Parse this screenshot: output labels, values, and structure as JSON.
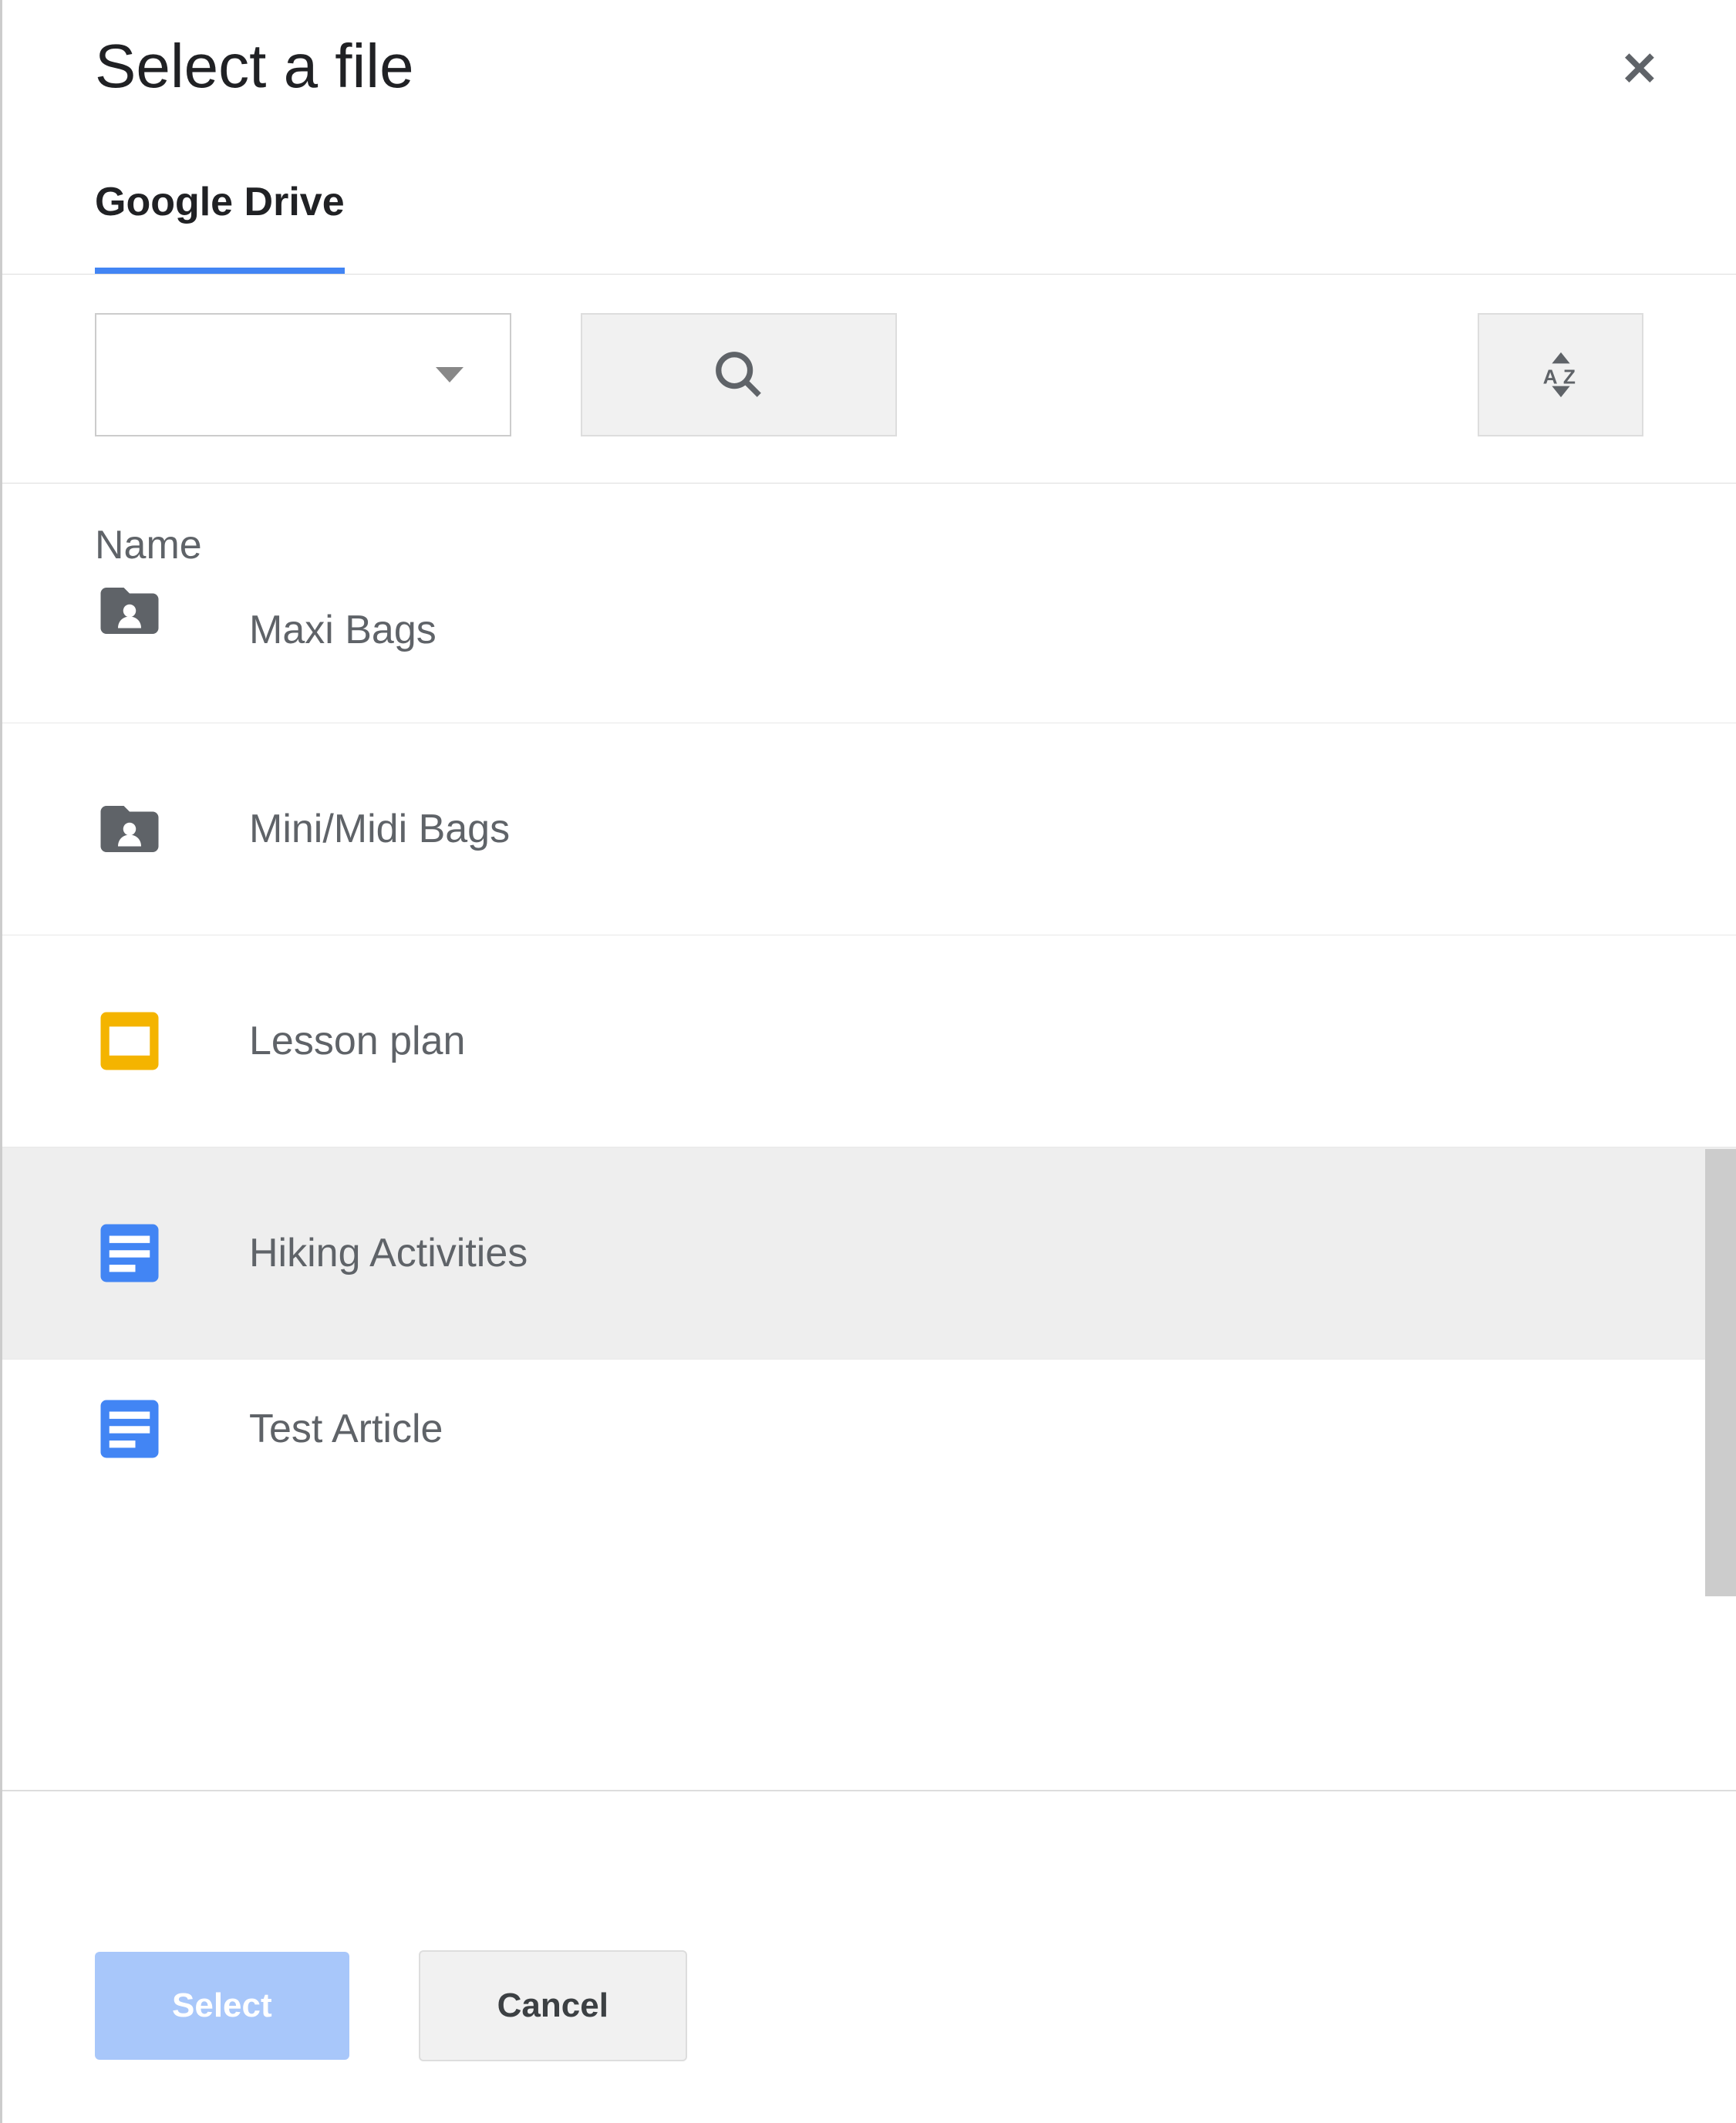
{
  "dialog": {
    "title": "Select a file"
  },
  "tabs": [
    {
      "label": "Google Drive",
      "active": true
    }
  ],
  "columnHeader": "Name",
  "files": [
    {
      "name": "Maxi Bags",
      "type": "shared-folder"
    },
    {
      "name": "Mini/Midi Bags",
      "type": "shared-folder"
    },
    {
      "name": "Lesson plan",
      "type": "slides"
    },
    {
      "name": "Hiking Activities",
      "type": "doc",
      "selected": true
    },
    {
      "name": "Test Article",
      "type": "doc"
    }
  ],
  "buttons": {
    "select": "Select",
    "cancel": "Cancel"
  }
}
